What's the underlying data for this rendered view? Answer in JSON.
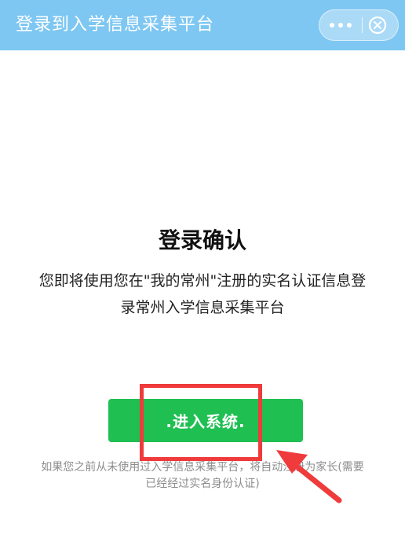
{
  "titlebar": {
    "title": "登录到入学信息采集平台",
    "more_icon": "more-dots-icon",
    "close_icon": "close-circle-icon"
  },
  "main": {
    "heading": "登录确认",
    "description": "您即将使用您在\"我的常州\"注册的实名认证信息登录常州入学信息采集平台",
    "enter_button_label": ".进入系统.",
    "hint": "如果您之前从未使用过入学信息采集平台，将自动注册为家长(需要已经经过实名身份认证)"
  },
  "annotation": {
    "highlight_color": "#ef3b3b",
    "arrow_icon": "red-arrow-icon"
  },
  "colors": {
    "titlebar_bg": "#7ec7f2",
    "button_bg": "#1fbf52",
    "annotation": "#ef3b3b"
  }
}
